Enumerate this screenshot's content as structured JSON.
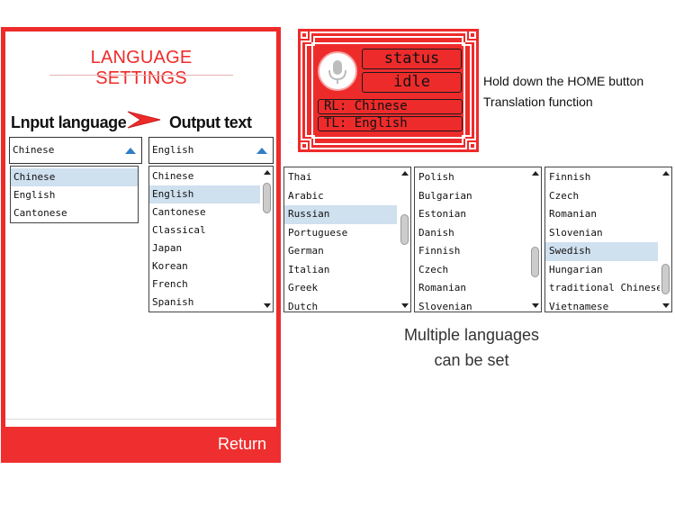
{
  "settings": {
    "title": "LANGUAGE SETTINGS",
    "input_label": "Lnput language",
    "output_label": "Output text",
    "input_select_value": "Chinese",
    "output_select_value": "English",
    "input_list": [
      {
        "label": "Chinese",
        "selected": true
      },
      {
        "label": "English",
        "selected": false
      },
      {
        "label": "Cantonese",
        "selected": false
      }
    ],
    "output_list": [
      {
        "label": "Chinese",
        "selected": false
      },
      {
        "label": "English",
        "selected": true
      },
      {
        "label": "Cantonese",
        "selected": false
      },
      {
        "label": "Classical",
        "selected": false
      },
      {
        "label": "Japan",
        "selected": false
      },
      {
        "label": "Korean",
        "selected": false
      },
      {
        "label": "French",
        "selected": false
      },
      {
        "label": "Spanish",
        "selected": false
      }
    ],
    "return_label": "Return"
  },
  "device": {
    "status_label": "status",
    "state_label": "idle",
    "rl_label": "RL: Chinese",
    "tl_label": "TL: English",
    "hint_line1": "Hold down the HOME button",
    "hint_line2": "Translation function"
  },
  "language_lists": [
    {
      "items": [
        "Thai",
        "Arabic",
        "Russian",
        "Portuguese",
        "German",
        "Italian",
        "Greek",
        "Dutch"
      ],
      "selected_index": 2
    },
    {
      "items": [
        "Polish",
        "Bulgarian",
        "Estonian",
        "Danish",
        "Finnish",
        "Czech",
        "Romanian",
        "Slovenian"
      ],
      "selected_index": -1
    },
    {
      "items": [
        "Finnish",
        "Czech",
        "Romanian",
        "Slovenian",
        "Swedish",
        "Hungarian",
        "traditional Chinese",
        "Vietnamese"
      ],
      "selected_index": 4
    }
  ],
  "caption": {
    "line1": "Multiple languages",
    "line2": "can be set"
  },
  "colors": {
    "accent_red": "#ee2b2b",
    "selection": "#cfe0ef",
    "dropdown_arrow": "#2f7fc6"
  }
}
